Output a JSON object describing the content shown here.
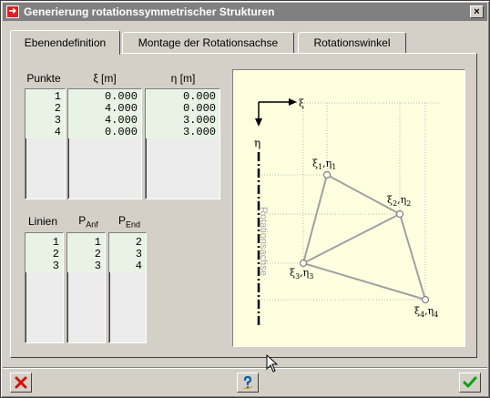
{
  "window": {
    "title": "Generierung rotationssymmetrischer Strukturen",
    "close_label": "×"
  },
  "tabs": [
    {
      "label": "Ebenendefinition",
      "active": true
    },
    {
      "label": "Montage der Rotationsachse",
      "active": false
    },
    {
      "label": "Rotationswinkel",
      "active": false
    }
  ],
  "points_table": {
    "headers": [
      "Punkte",
      "ξ [m]",
      "η [m]"
    ],
    "rows": [
      [
        "1",
        "0.000",
        "0.000"
      ],
      [
        "2",
        "4.000",
        "0.000"
      ],
      [
        "3",
        "4.000",
        "3.000"
      ],
      [
        "4",
        "0.000",
        "3.000"
      ]
    ]
  },
  "lines_table": {
    "headers": {
      "lines": "Linien",
      "p_anf": "P",
      "p_anf_sub": "Anf",
      "p_end": "P",
      "p_end_sub": "End"
    },
    "rows": [
      [
        "1",
        "1",
        "2"
      ],
      [
        "2",
        "2",
        "3"
      ],
      [
        "3",
        "3",
        "4"
      ]
    ]
  },
  "diagram": {
    "axis_xi": "ξ",
    "axis_eta": "η",
    "rotation_axis_label": "Rotationsachse",
    "points": [
      {
        "xi": "ξ",
        "eta": "η",
        "sub1": "1",
        "sub2": "1"
      },
      {
        "xi": "ξ",
        "eta": "η",
        "sub1": "2",
        "sub2": "2"
      },
      {
        "xi": "ξ",
        "eta": "η",
        "sub1": "3",
        "sub2": "3"
      },
      {
        "xi": "ξ",
        "eta": "η",
        "sub1": "4",
        "sub2": "4"
      }
    ]
  },
  "buttons": {
    "cancel_icon": "red-x-icon",
    "help_icon": "help-question-icon",
    "ok_icon": "green-check-icon"
  },
  "colors": {
    "title_bar": "#808080",
    "list_fill": "#e8f3e6",
    "diagram_bg": "#ffffe0",
    "cancel": "#d01010",
    "ok": "#10a010"
  }
}
